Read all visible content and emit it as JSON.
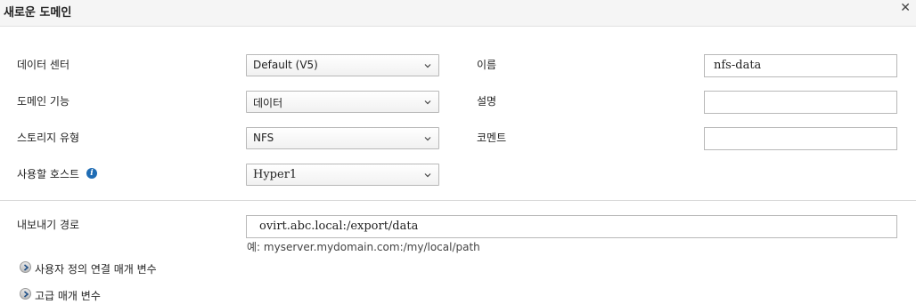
{
  "dialog": {
    "title": "새로운 도메인",
    "close_glyph": "✕"
  },
  "left_form": {
    "data_center_label": "데이터 센터",
    "data_center_value": "Default (V5)",
    "domain_function_label": "도메인 기능",
    "domain_function_value": "데이터",
    "storage_type_label": "스토리지 유형",
    "storage_type_value": "NFS",
    "host_label": "사용할 호스트",
    "host_value": "Hyper1",
    "host_info_icon": "info-icon"
  },
  "right_form": {
    "name_label": "이름",
    "name_value": "nfs-data",
    "description_label": "설명",
    "description_value": "",
    "comment_label": "코멘트",
    "comment_value": ""
  },
  "export": {
    "label": "내보내기 경로",
    "value": "ovirt.abc.local:/export/data",
    "hint": "예: myserver.mydomain.com:/my/local/path"
  },
  "expanders": {
    "custom_params": "사용자 정의 연결 매개 변수",
    "advanced_params": "고급 매개 변수"
  },
  "colors": {
    "accent": "#1f6cb4",
    "border": "#b8b8b8",
    "header_bg": "#f5f5f5"
  }
}
